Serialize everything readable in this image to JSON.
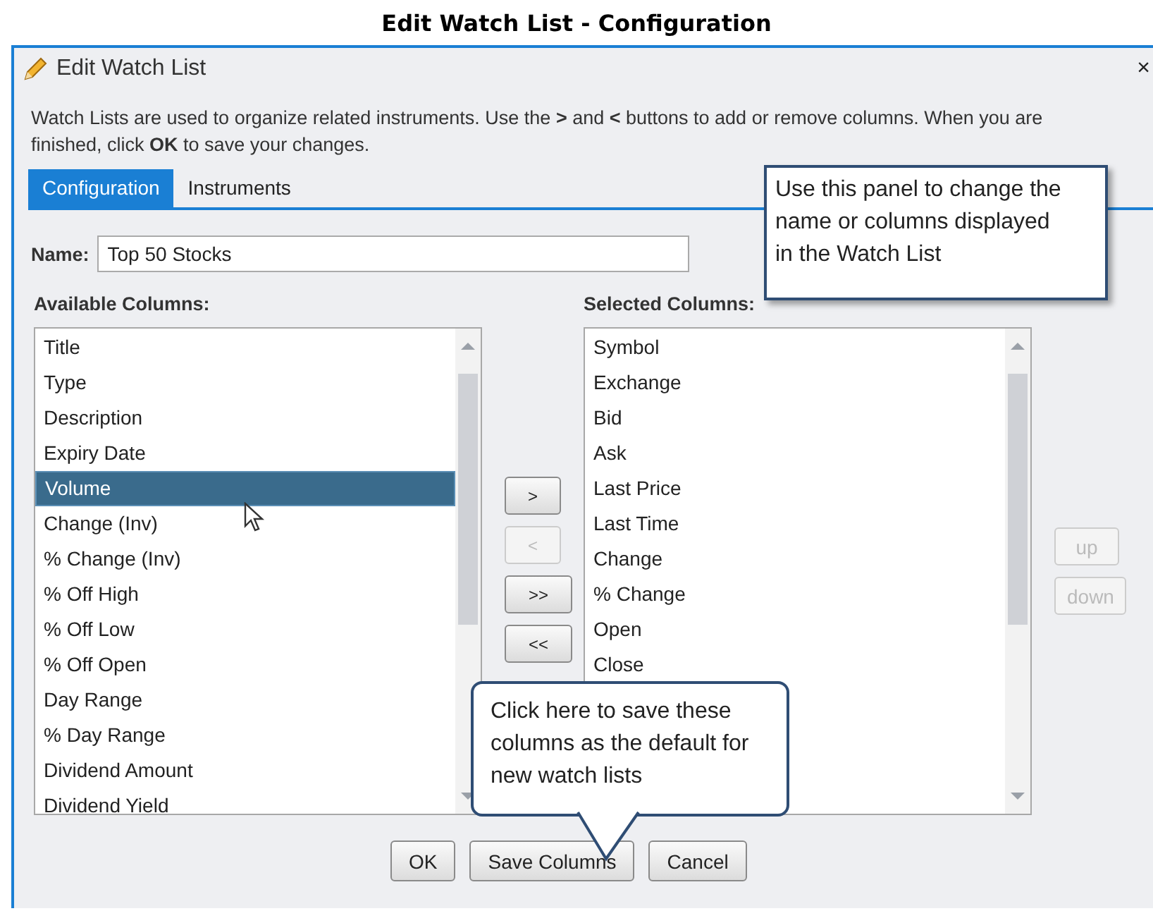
{
  "page_title": "Edit Watch List - Configuration",
  "window": {
    "title": "Edit Watch List",
    "close": "×"
  },
  "description": "Watch Lists are used to organize related instruments. Use the **>** and **<** buttons to add or remove columns. When you are finished, click **OK** to save your changes.",
  "tabs": [
    {
      "label": "Configuration",
      "selected": true
    },
    {
      "label": "Instruments",
      "selected": false
    }
  ],
  "name_field": {
    "label": "Name:",
    "value": "Top 50 Stocks"
  },
  "available_columns": {
    "label": "Available Columns:",
    "items": [
      {
        "label": "Title",
        "selected": false
      },
      {
        "label": "Type",
        "selected": false
      },
      {
        "label": "Description",
        "selected": false
      },
      {
        "label": "Expiry Date",
        "selected": false
      },
      {
        "label": "Volume",
        "selected": true
      },
      {
        "label": "Change (Inv)",
        "selected": false
      },
      {
        "label": "% Change (Inv)",
        "selected": false
      },
      {
        "label": "% Off High",
        "selected": false
      },
      {
        "label": "% Off Low",
        "selected": false
      },
      {
        "label": "% Off Open",
        "selected": false
      },
      {
        "label": "Day Range",
        "selected": false
      },
      {
        "label": "% Day Range",
        "selected": false
      },
      {
        "label": "Dividend Amount",
        "selected": false
      },
      {
        "label": "Dividend Yield",
        "selected": false
      }
    ]
  },
  "transfer_buttons": [
    {
      "label": ">",
      "disabled": false
    },
    {
      "label": "<",
      "disabled": true
    },
    {
      "label": ">>",
      "disabled": false
    },
    {
      "label": "<<",
      "disabled": false
    }
  ],
  "selected_columns": {
    "label": "Selected Columns:",
    "items": [
      {
        "label": "Symbol",
        "selected": false
      },
      {
        "label": "Exchange",
        "selected": false
      },
      {
        "label": "Bid",
        "selected": false
      },
      {
        "label": "Ask",
        "selected": false
      },
      {
        "label": "Last Price",
        "selected": false
      },
      {
        "label": "Last Time",
        "selected": false
      },
      {
        "label": "Change",
        "selected": false
      },
      {
        "label": "% Change",
        "selected": false
      },
      {
        "label": "Open",
        "selected": false
      },
      {
        "label": "Close",
        "selected": false
      }
    ]
  },
  "order_buttons": [
    {
      "label": "up",
      "disabled": true
    },
    {
      "label": "down",
      "disabled": true
    }
  ],
  "buttons": [
    "OK",
    "Save Columns",
    "Cancel"
  ],
  "callouts": [
    {
      "text": "Use this panel to change the name or columns displayed in the Watch List"
    },
    {
      "text": "Click here to save these columns as the default for new watch lists"
    }
  ]
}
